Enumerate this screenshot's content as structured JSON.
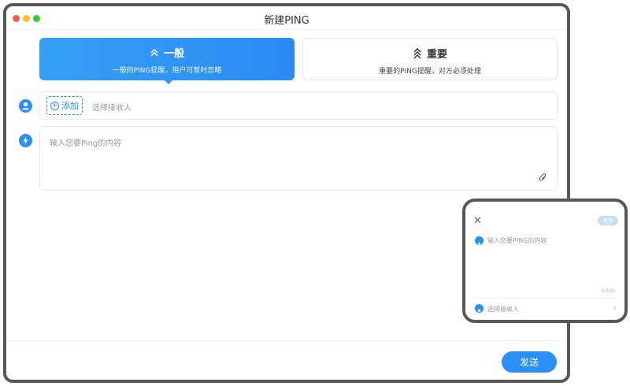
{
  "window": {
    "title": "新建PING"
  },
  "tabs": [
    {
      "label": "一般",
      "subtitle": "一般的PING提醒，用户可暂时忽略",
      "icon": "double-chevron-up-icon"
    },
    {
      "label": "重要",
      "subtitle": "重要的PING提醒，对方必须处理",
      "icon": "triple-chevron-up-icon"
    }
  ],
  "recipient": {
    "add_label": "添加",
    "placeholder": "选择接收人"
  },
  "content": {
    "placeholder": "输入您要Ping的内容"
  },
  "footer": {
    "send_label": "发送"
  },
  "phone": {
    "send_label": "发送",
    "content_placeholder": "输入您要PING的内容",
    "counter": "0/500",
    "recipient_placeholder": "选择接收人"
  },
  "colors": {
    "accent": "#2a8ff6",
    "frame": "#55595e"
  }
}
